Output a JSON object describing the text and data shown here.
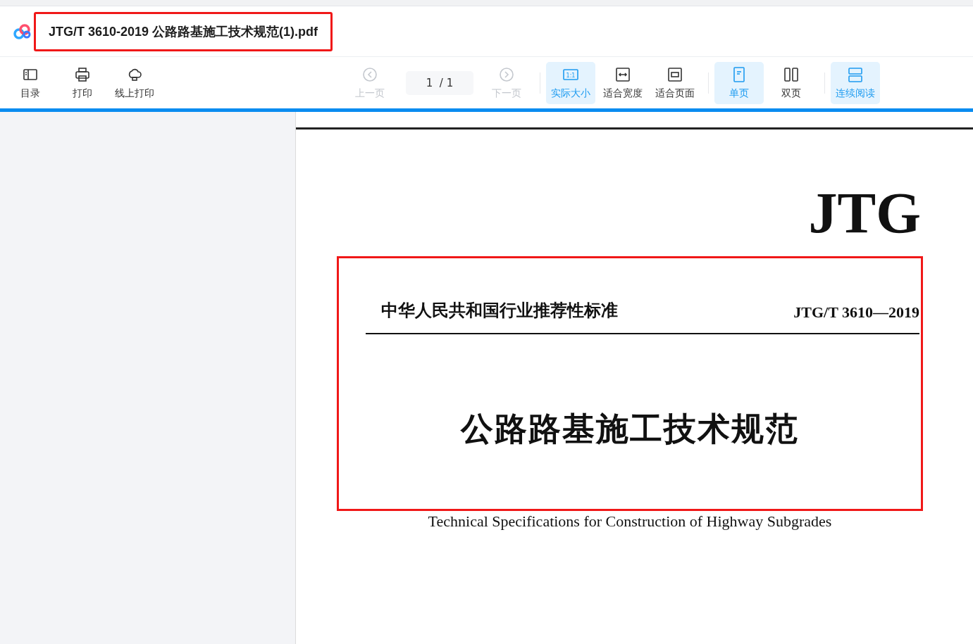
{
  "header": {
    "title": "JTG/T 3610-2019 公路路基施工技术规范(1).pdf",
    "highlighted": true
  },
  "toolbar": [
    {
      "kind": "toc",
      "label": "目录",
      "selected": false,
      "disabled": false
    },
    {
      "kind": "print",
      "label": "打印",
      "selected": false,
      "disabled": false
    },
    {
      "kind": "online-print",
      "label": "线上打印",
      "selected": false,
      "disabled": false
    },
    {
      "kind": "prev",
      "label": "上一页",
      "selected": false,
      "disabled": true
    },
    {
      "kind": "page",
      "label": "1  / 1"
    },
    {
      "kind": "next",
      "label": "下一页",
      "selected": false,
      "disabled": true
    },
    {
      "kind": "actual-size",
      "icon_text": "1:1",
      "label": "实际大小",
      "selected": true,
      "disabled": false
    },
    {
      "kind": "fit-width",
      "label": "适合宽度",
      "selected": false,
      "disabled": false
    },
    {
      "kind": "fit-page",
      "label": "适合页面",
      "selected": false,
      "disabled": false
    },
    {
      "kind": "single",
      "label": "单页",
      "selected": true,
      "disabled": false
    },
    {
      "kind": "double",
      "label": "双页",
      "selected": false,
      "disabled": false
    },
    {
      "kind": "continuous",
      "label": "连续阅读",
      "selected": true,
      "disabled": false
    }
  ],
  "document": {
    "logo": "JTG",
    "category": "中华人民共和国行业推荐性标准",
    "code": "JTG/T 3610—2019",
    "title": "公路路基施工技术规范",
    "subtitle": "Technical Specifications for Construction of Highway Subgrades",
    "highlighted": true
  }
}
